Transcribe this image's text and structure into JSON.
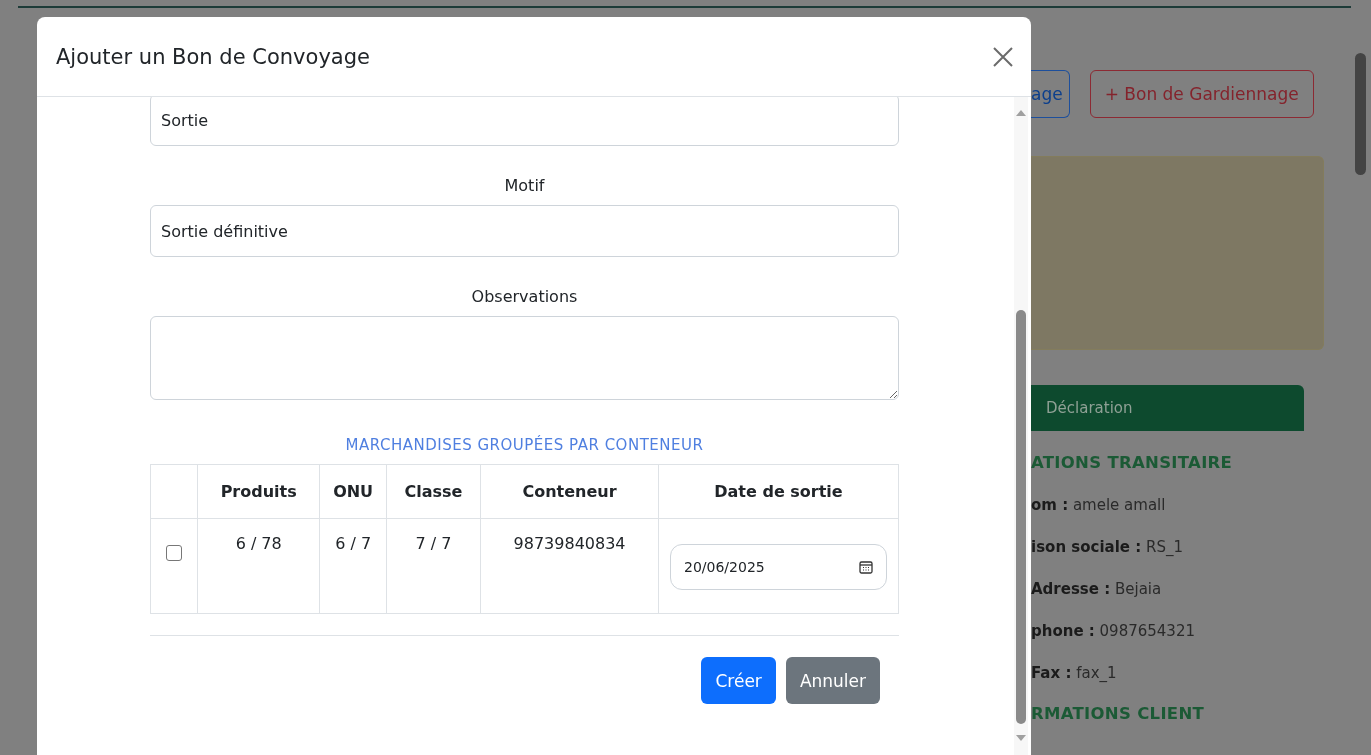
{
  "background": {
    "buttons": [
      {
        "label": "age",
        "kind": "outline-primary"
      },
      {
        "label": "+ Bon de Gardiennage",
        "kind": "outline-danger"
      }
    ],
    "tab": {
      "label": "Déclaration",
      "selected": true
    },
    "sections": [
      {
        "title": "ATIONS TRANSITAIRE",
        "rows": [
          {
            "label": "om :",
            "value": "amele amall"
          },
          {
            "label": "ison sociale :",
            "value": "RS_1"
          },
          {
            "label": "Adresse :",
            "value": "Bejaia"
          },
          {
            "label": "phone :",
            "value": "0987654321"
          },
          {
            "label": "Fax :",
            "value": "fax_1"
          }
        ]
      },
      {
        "title": "RMATIONS CLIENT"
      }
    ]
  },
  "modal": {
    "title": "Ajouter un Bon de Convoyage",
    "fields": [
      {
        "kind": "input",
        "value": "Sortie"
      },
      {
        "kind": "input",
        "label": "Motif",
        "value": "Sortie définitive"
      },
      {
        "kind": "textarea",
        "label": "Observations"
      }
    ],
    "table": {
      "title": "MARCHANDISES GROUPÉES PAR CONTENEUR",
      "columns": [
        "Produits",
        "ONU",
        "Classe",
        "Conteneur",
        "Date de sortie"
      ],
      "rows": [
        {
          "checked": false,
          "cells": [
            "6 / 78",
            "6 / 7",
            "7 / 7",
            "98739840834"
          ],
          "date": "20/06/2025"
        }
      ]
    },
    "buttons": [
      {
        "label": "Créer",
        "kind": "primary"
      },
      {
        "label": "Annuler",
        "kind": "secondary"
      }
    ]
  }
}
